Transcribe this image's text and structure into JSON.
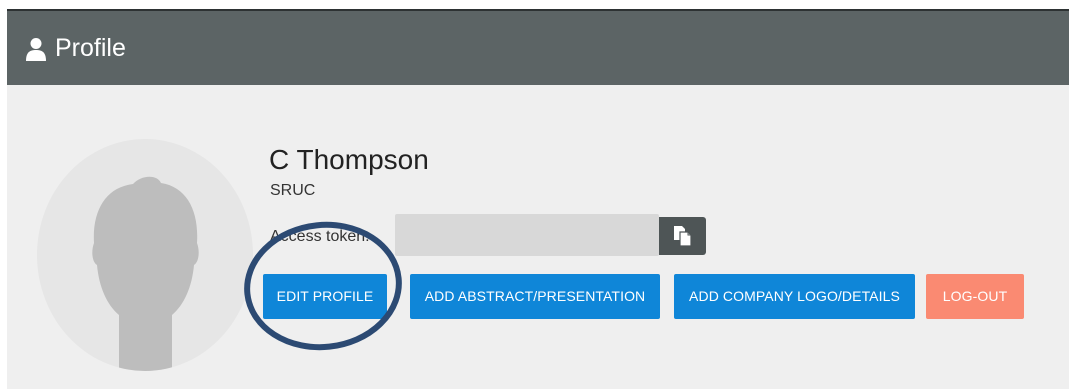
{
  "header": {
    "icon": "user-icon",
    "title": "Profile"
  },
  "profile": {
    "avatar_icon": "user-silhouette-icon",
    "name": "C Thompson",
    "organization": "SRUC",
    "access_token_label": "Access token:",
    "access_token_value": "",
    "copy_icon": "copy-icon"
  },
  "actions": {
    "edit_profile": "EDIT PROFILE",
    "add_abstract": "ADD ABSTRACT/PRESENTATION",
    "add_company_logo": "ADD COMPANY LOGO/DETAILS",
    "log_out": "LOG-OUT"
  },
  "colors": {
    "header_bg": "#5c6465",
    "primary_button": "#0f86d8",
    "logout_button": "#fa8a72",
    "annotation_circle": "#2c4a73"
  }
}
